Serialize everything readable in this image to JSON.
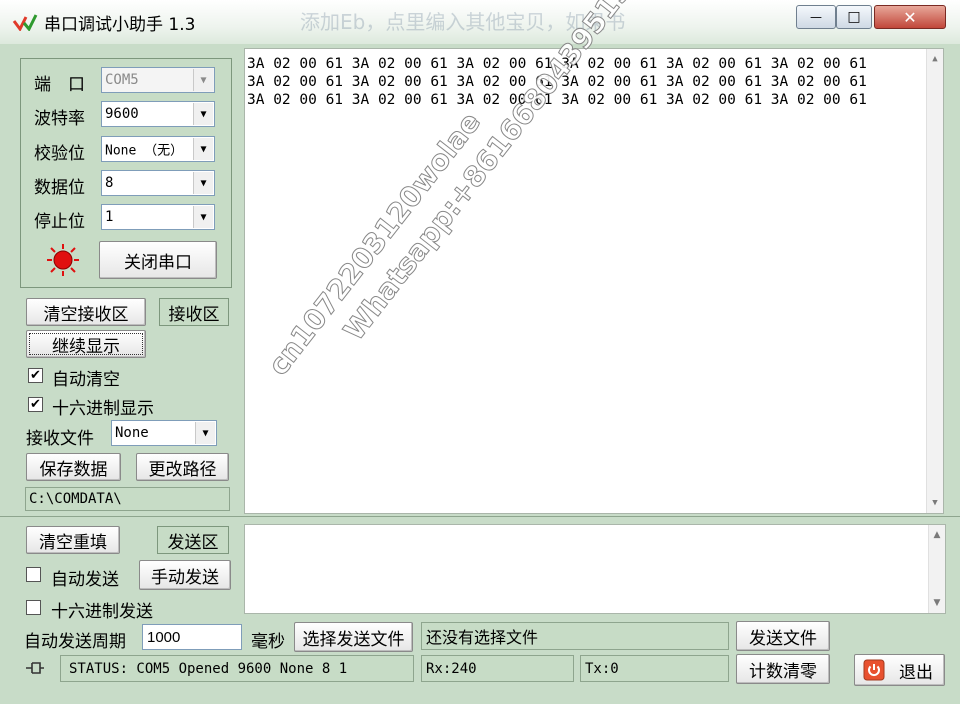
{
  "window": {
    "title": "串口调试小助手 1.3",
    "controls": {
      "minimize": "—",
      "maximize": "□",
      "close": "✕"
    },
    "title_bg_text": "添加Eb，点里编入其他宝贝，如果书"
  },
  "serial_settings": {
    "port_label": "端　口",
    "port_value": "COM5",
    "baud_label": "波特率",
    "baud_value": "9600",
    "parity_label": "校验位",
    "parity_value": "None （无）",
    "databits_label": "数据位",
    "databits_value": "8",
    "stopbits_label": "停止位",
    "stopbits_value": "1",
    "close_port_button": "关闭串口",
    "led_color": "#e01010"
  },
  "receive_controls": {
    "clear_button": "清空接收区",
    "area_label": "接收区",
    "continue_button": "继续显示",
    "auto_clear_label": "自动清空",
    "auto_clear_checked": "✔",
    "hex_display_label": "十六进制显示",
    "hex_display_checked": "✔",
    "file_label": "接收文件",
    "file_value": "None",
    "save_button": "保存数据",
    "change_path_button": "更改路径",
    "path": "C:\\COMDATA\\"
  },
  "receive_area": {
    "lines": [
      "3A 02 00 61 3A 02 00 61 3A 02 00 61 3A 02 00 61 3A 02 00 61 3A 02 00 61",
      "3A 02 00 61 3A 02 00 61 3A 02 00 61 3A 02 00 61 3A 02 00 61 3A 02 00 61",
      "3A 02 00 61 3A 02 00 61 3A 02 00 61 3A 02 00 61 3A 02 00 61 3A 02 00 61"
    ]
  },
  "watermark": {
    "line1": "cn1072203120wolae",
    "line2": "Whatsapp:+8616680439519"
  },
  "send_controls": {
    "clear_button": "清空重填",
    "area_label": "发送区",
    "auto_send_label": "自动发送",
    "manual_send_button": "手动发送",
    "hex_send_label": "十六进制发送",
    "period_label": "自动发送周期",
    "period_value": "1000",
    "ms_label": "毫秒",
    "select_file_button": "选择发送文件",
    "file_status": "还没有选择文件",
    "send_file_button": "发送文件"
  },
  "status_bar": {
    "status_text": "STATUS: COM5 Opened 9600 None  8 1",
    "rx_text": "Rx:240",
    "tx_text": "Tx:0",
    "reset_count_button": "计数清零",
    "exit_button": "退出"
  },
  "colors": {
    "panel_bg": "#c7dcc6",
    "title_accent": "#3a9a3a"
  }
}
